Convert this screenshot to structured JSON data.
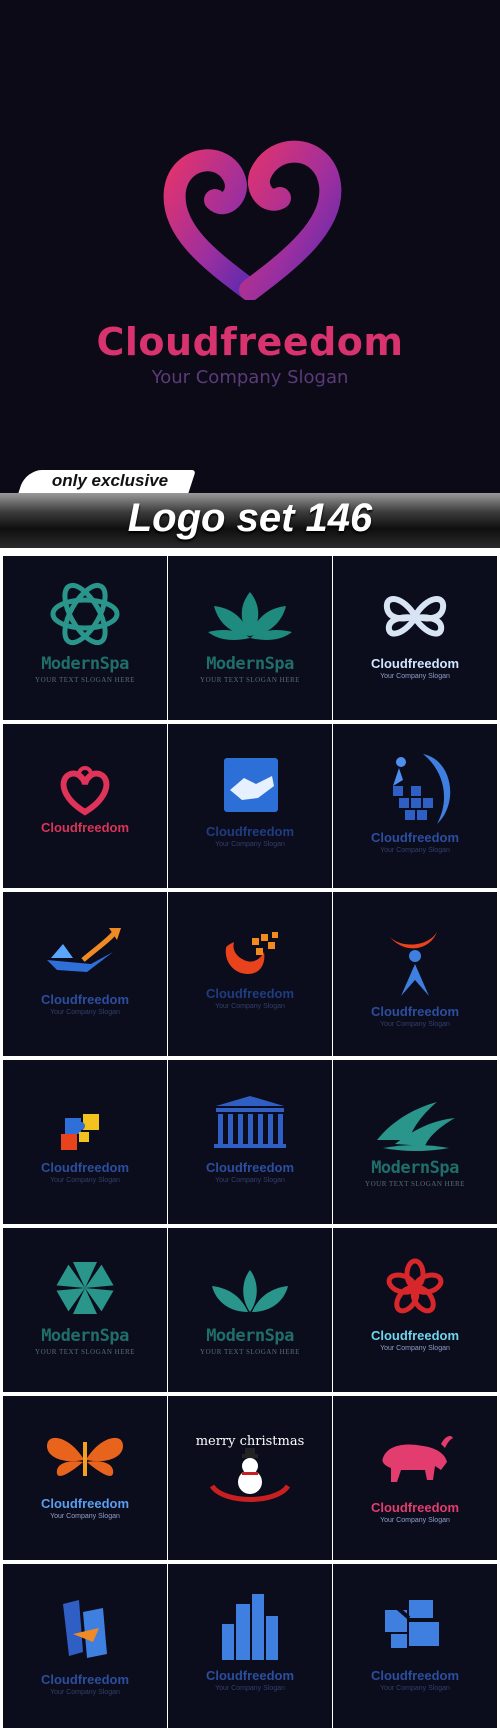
{
  "hero": {
    "company_name": "Cloudfreedom",
    "slogan": "Your Company Slogan"
  },
  "badge": "only exclusive",
  "title": "Logo set 146",
  "logos": [
    {
      "name": "ModernSpa",
      "slogan": "YOUR TEXT SLOGAN HERE"
    },
    {
      "name": "ModernSpa",
      "slogan": "YOUR TEXT SLOGAN HERE"
    },
    {
      "name": "Cloudfreedom",
      "slogan": "Your Company Slogan"
    },
    {
      "name": "Cloudfreedom",
      "slogan": ""
    },
    {
      "name": "Cloudfreedom",
      "slogan": "Your Company Slogan"
    },
    {
      "name": "Cloudfreedom",
      "slogan": "Your Company Slogan"
    },
    {
      "name": "Cloudfreedom",
      "slogan": "Your Company Slogan"
    },
    {
      "name": "Cloudfreedom",
      "slogan": "Your Company Slogan"
    },
    {
      "name": "Cloudfreedom",
      "slogan": "Your Company Slogan"
    },
    {
      "name": "Cloudfreedom",
      "slogan": "Your Company Slogan"
    },
    {
      "name": "Cloudfreedom",
      "slogan": "Your Company Slogan"
    },
    {
      "name": "ModernSpa",
      "slogan": "YOUR TEXT SLOGAN HERE"
    },
    {
      "name": "ModernSpa",
      "slogan": "YOUR TEXT SLOGAN HERE"
    },
    {
      "name": "ModernSpa",
      "slogan": "YOUR TEXT SLOGAN HERE"
    },
    {
      "name": "Cloudfreedom",
      "slogan": "Your Company Slogan"
    },
    {
      "name": "Cloudfreedom",
      "slogan": "Your Company Slogan"
    },
    {
      "name": "merry christmas",
      "slogan": ""
    },
    {
      "name": "Cloudfreedom",
      "slogan": "Your Company Slogan"
    },
    {
      "name": "Cloudfreedom",
      "slogan": "Your Company Slogan"
    },
    {
      "name": "Cloudfreedom",
      "slogan": "Your Company Slogan"
    },
    {
      "name": "Cloudfreedom",
      "slogan": "Your Company Slogan"
    }
  ],
  "colors": {
    "background": "#0b0c1c",
    "hero_name": "#d8336f",
    "hero_slogan": "#5a3b7a",
    "spa_teal": "#1f6e6a"
  }
}
